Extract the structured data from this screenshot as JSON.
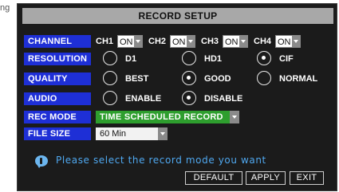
{
  "edge_fragment": "ng",
  "title": "RECORD SETUP",
  "channel": {
    "label": "CHANNEL",
    "items": [
      {
        "name": "CH1",
        "value": "ON"
      },
      {
        "name": "CH2",
        "value": "ON"
      },
      {
        "name": "CH3",
        "value": "ON"
      },
      {
        "name": "CH4",
        "value": "ON"
      }
    ]
  },
  "resolution": {
    "label": "RESOLUTION",
    "options": [
      "D1",
      "HD1",
      "CIF"
    ],
    "selected": "CIF"
  },
  "quality": {
    "label": "QUALITY",
    "options": [
      "BEST",
      "GOOD",
      "NORMAL"
    ],
    "selected": "GOOD"
  },
  "audio": {
    "label": "AUDIO",
    "options": [
      "ENABLE",
      "DISABLE"
    ],
    "selected": "DISABLE"
  },
  "rec_mode": {
    "label": "REC MODE",
    "value": "TIME SCHEDULED RECORD"
  },
  "file_size": {
    "label": "FILE SIZE",
    "value": "60 Min"
  },
  "hint": "Please select the record mode you want",
  "buttons": {
    "default": "DEFAULT",
    "apply": "APPLY",
    "exit": "EXIT"
  },
  "colors": {
    "label_bg": "#1e2fd6",
    "rec_mode_bg": "#2e9e2e",
    "hint_text": "#4fa8f0",
    "panel_bg": "#1b1b1b"
  }
}
